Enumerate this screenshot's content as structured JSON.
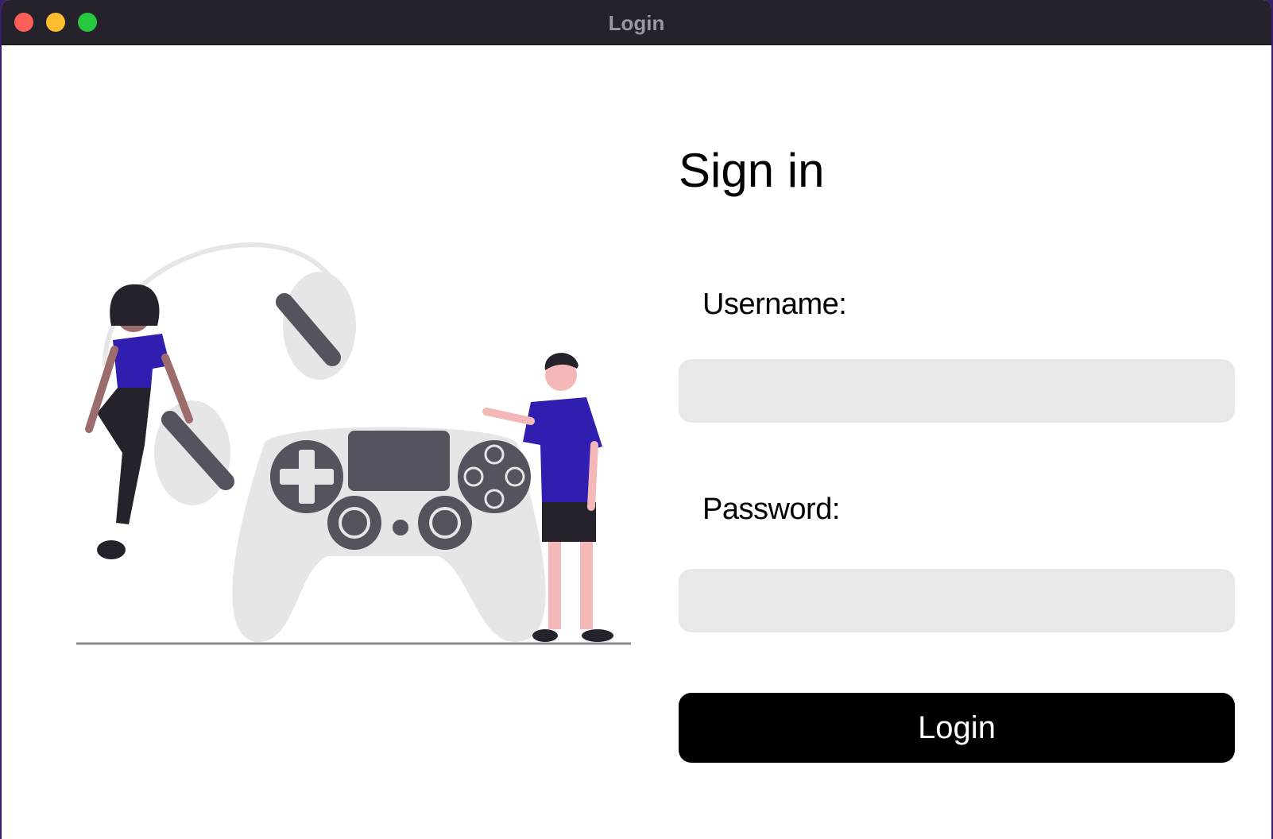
{
  "window": {
    "title": "Login"
  },
  "form": {
    "heading": "Sign in",
    "username_label": "Username:",
    "username_value": "",
    "password_label": "Password:",
    "password_value": "",
    "login_label": "Login"
  },
  "colors": {
    "titlebar": "#26222c",
    "field_bg": "#e7e8ea",
    "button_bg": "#000000",
    "accent_purple": "#2f1eb0",
    "illustration_gray": "#55545e",
    "illustration_light": "#e6e6e6"
  },
  "illustration": {
    "icon": "gaming-people-controller-illustration"
  }
}
